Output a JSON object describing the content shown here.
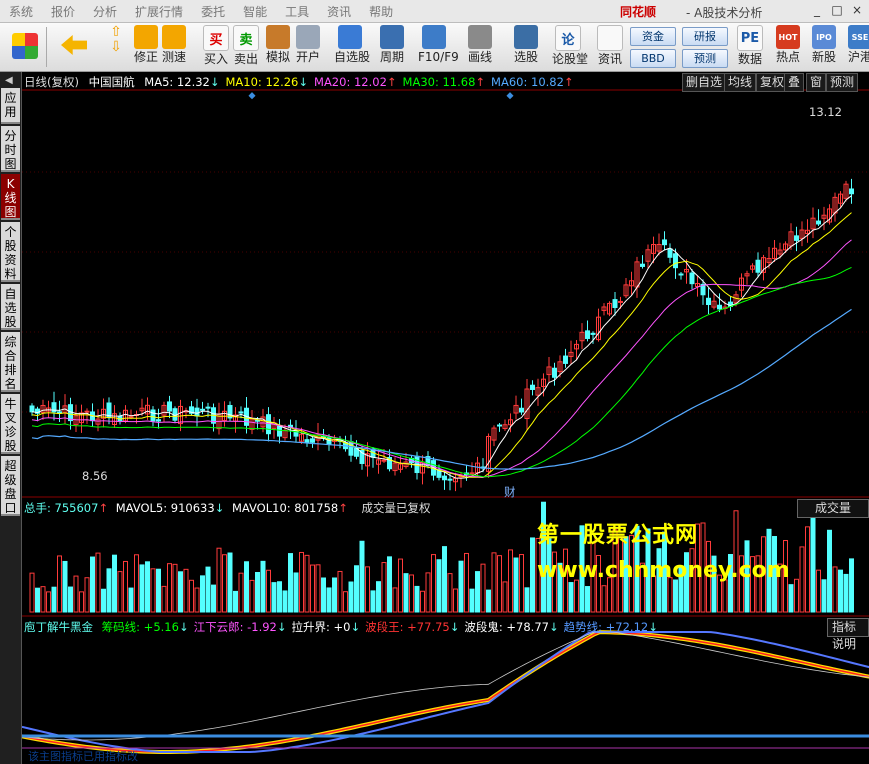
{
  "menu": [
    "系统",
    "报价",
    "分析",
    "扩展行情",
    "委托",
    "智能",
    "工具",
    "资讯",
    "帮助"
  ],
  "brand": "同花顺",
  "app_title": "- A股技术分析",
  "window_controls": [
    "_",
    "□",
    "×"
  ],
  "toolbar": {
    "buttons": [
      {
        "label": "修正",
        "icon": "correction-icon"
      },
      {
        "label": "测速",
        "icon": "speedtest-icon"
      },
      {
        "label": "买入",
        "icon": "buy-icon",
        "glyph": "买"
      },
      {
        "label": "卖出",
        "icon": "sell-icon",
        "glyph": "卖"
      },
      {
        "label": "模拟",
        "icon": "simulate-icon"
      },
      {
        "label": "开户",
        "icon": "open-account-icon"
      },
      {
        "label": "自选股",
        "icon": "watchlist-icon"
      },
      {
        "label": "周期",
        "icon": "period-icon"
      },
      {
        "label": "F10/F9",
        "icon": "f10-icon"
      },
      {
        "label": "画线",
        "icon": "draw-line-icon"
      },
      {
        "label": "选股",
        "icon": "stock-select-icon"
      },
      {
        "label": "论股堂",
        "icon": "forum-icon",
        "glyph": "论"
      },
      {
        "label": "资讯",
        "icon": "news-icon"
      },
      {
        "label": "数据",
        "icon": "data-icon",
        "glyph": "PE"
      },
      {
        "label": "热点",
        "icon": "hot-icon",
        "glyph": "HOT"
      },
      {
        "label": "新股",
        "icon": "new-stock-icon",
        "glyph": "IPO"
      },
      {
        "label": "沪港",
        "icon": "hk-connect-icon",
        "glyph": "SSE"
      }
    ],
    "small_buttons": [
      "资金",
      "研报",
      "BBD",
      "预测"
    ]
  },
  "sidebar": {
    "tabs": [
      "应用",
      "分时图",
      "K线图",
      "个股资料",
      "自选股",
      "综合排名",
      "牛叉诊股",
      "超级盘口"
    ],
    "active_index": 2
  },
  "price_header": {
    "period": "日线(复权)",
    "stock": "中国国航",
    "ma": [
      {
        "label": "MA5: 12.32",
        "arrow": "↓",
        "color": "#ffffff"
      },
      {
        "label": "MA10: 12.26",
        "arrow": "↓",
        "color": "#ffff00"
      },
      {
        "label": "MA20: 12.02",
        "arrow": "↑",
        "color": "#ff55ff"
      },
      {
        "label": "MA30: 11.68",
        "arrow": "↑",
        "color": "#00ff00"
      },
      {
        "label": "MA60: 10.82",
        "arrow": "↑",
        "color": "#55aaff"
      }
    ]
  },
  "right_buttons": [
    "删自选",
    "均线",
    "复权",
    "叠",
    "窗",
    "预测"
  ],
  "annotations": {
    "high": "13.12",
    "low": "8.56",
    "finance_marker": "财"
  },
  "volume_header": {
    "total": "总手: 755607",
    "total_arrow": "↑",
    "mavol5": "MAVOL5: 910633",
    "mavol5_arrow": "↓",
    "mavol10": "MAVOL10: 801758",
    "mavol10_arrow": "↑",
    "note": "成交量已复权",
    "panel_button": "成交量"
  },
  "indicator_header": {
    "name": "庖丁解牛黑金",
    "items": [
      {
        "label": "筹码线: +5.16",
        "arrow": "↓",
        "color": "#00ff00"
      },
      {
        "label": "江下云郎: -1.92",
        "arrow": "↓",
        "color": "#ff55ff"
      },
      {
        "label": "拉升界: +0",
        "arrow": "↓",
        "color": "#ffffff"
      },
      {
        "label": "波段王: +77.75",
        "arrow": "↓",
        "color": "#ff3333"
      },
      {
        "label": "波段鬼: +78.77",
        "arrow": "↓",
        "color": "#ffffff"
      },
      {
        "label": "趋势线: +72.12",
        "arrow": "↓",
        "color": "#5599ff"
      }
    ],
    "panel_button": "指标说明"
  },
  "bottom_note": "该主图指标已用指标改",
  "watermark": {
    "line1": "第一股票公式网",
    "line2": "www.chnmoney.com"
  },
  "colors": {
    "up": "#ff3b3b",
    "down": "#54ffff",
    "ma5": "#ffffff",
    "ma10": "#ffff00",
    "ma20": "#ff55ff",
    "ma30": "#00ff00",
    "ma60": "#55aaff",
    "grid": "#8b0000"
  }
}
